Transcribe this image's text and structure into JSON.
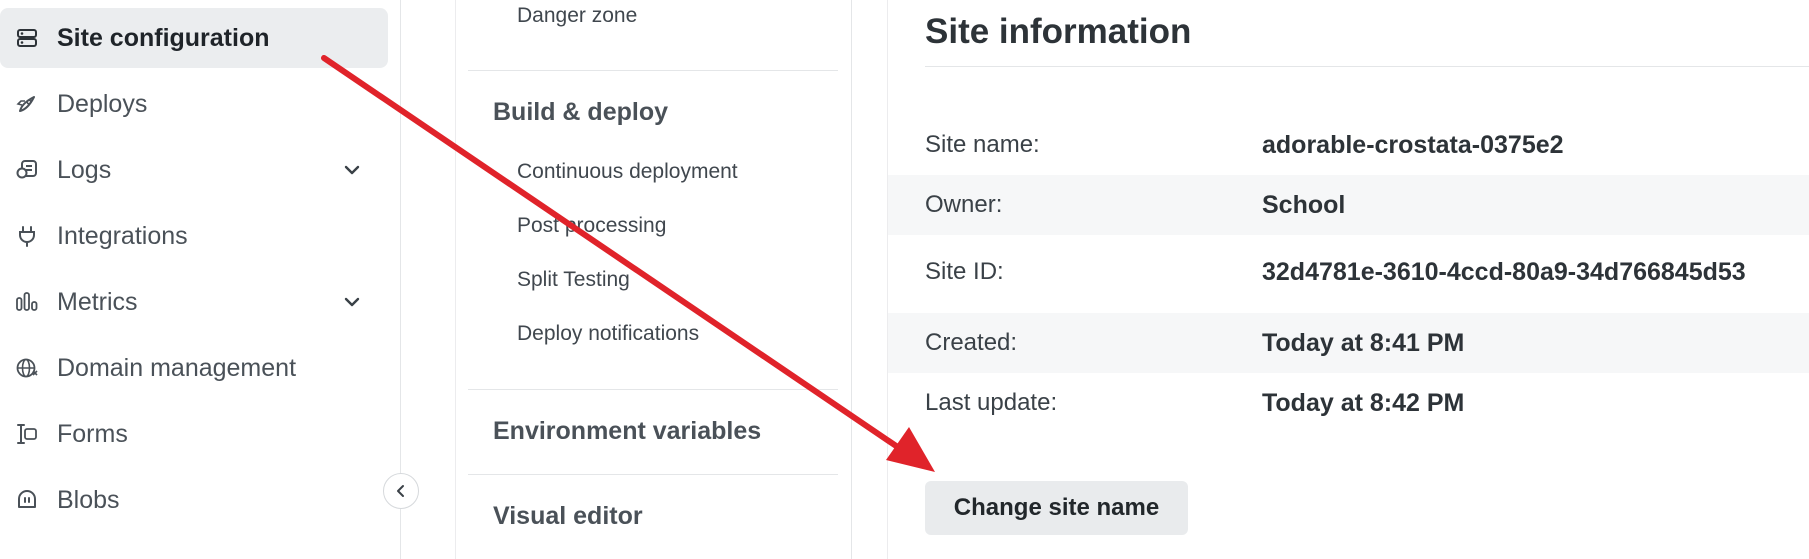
{
  "sidebar": {
    "items": [
      {
        "label": "Site configuration",
        "icon": "server-icon"
      },
      {
        "label": "Deploys",
        "icon": "rocket-icon"
      },
      {
        "label": "Logs",
        "icon": "logs-icon"
      },
      {
        "label": "Integrations",
        "icon": "plug-icon"
      },
      {
        "label": "Metrics",
        "icon": "bar-chart-icon"
      },
      {
        "label": "Domain management",
        "icon": "globe-icon"
      },
      {
        "label": "Forms",
        "icon": "form-icon"
      },
      {
        "label": "Blobs",
        "icon": "blob-icon"
      }
    ]
  },
  "settings_nav": {
    "general_sub": [
      "Danger zone"
    ],
    "build_deploy": {
      "heading": "Build & deploy",
      "sub": [
        "Continuous deployment",
        "Post processing",
        "Split Testing",
        "Deploy notifications"
      ]
    },
    "env_vars": "Environment variables",
    "visual_editor": "Visual editor"
  },
  "site_info": {
    "title": "Site information",
    "rows": [
      {
        "key": "Site name:",
        "value": "adorable-crostata-0375e2"
      },
      {
        "key": "Owner:",
        "value": "School"
      },
      {
        "key": "Site ID:",
        "value": "32d4781e-3610-4ccd-80a9-34d766845d53"
      },
      {
        "key": "Created:",
        "value": "Today at 8:41 PM"
      },
      {
        "key": "Last update:",
        "value": "Today at 8:42 PM"
      }
    ],
    "change_button": "Change site name"
  },
  "colors": {
    "annotation_arrow": "#e0232a",
    "active_nav_bg": "#ebedef",
    "button_bg": "#e9ebed"
  }
}
